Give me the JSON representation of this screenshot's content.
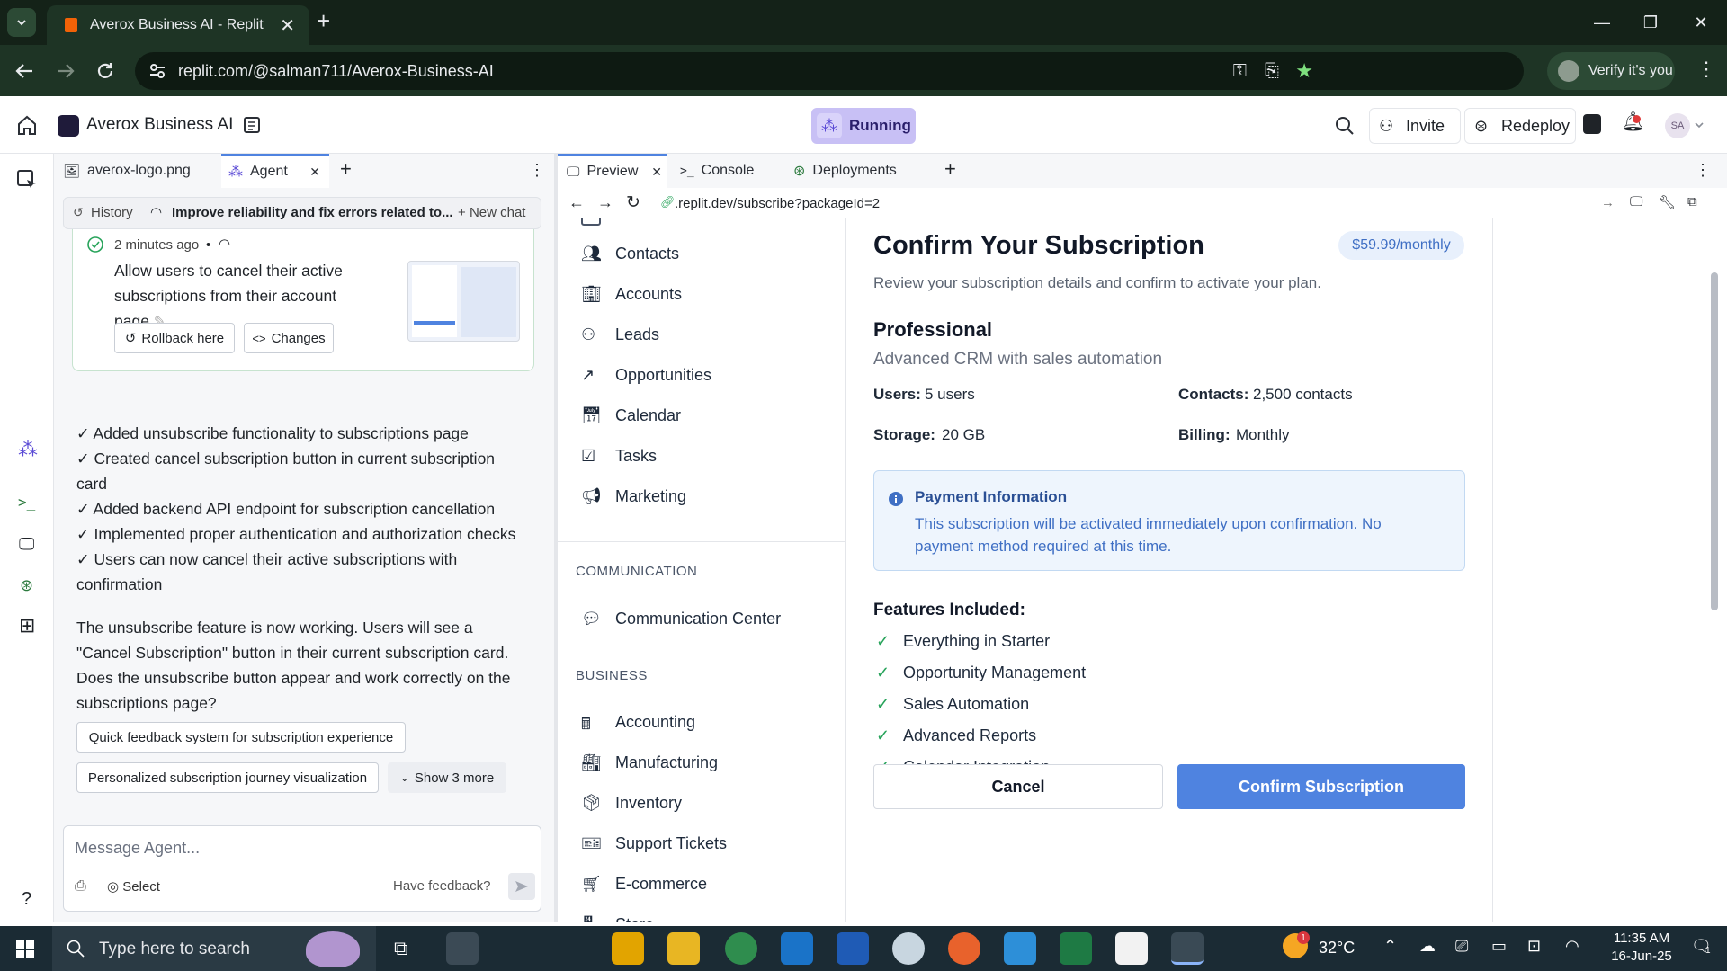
{
  "browser": {
    "tab_title": "Averox Business AI - Replit",
    "url": "replit.com/@salman711/Averox-Business-AI",
    "verify_label": "Verify it's you"
  },
  "app": {
    "project_name": "Averox Business AI",
    "status": "Running",
    "invite_label": "Invite",
    "redeploy_label": "Redeploy",
    "avatar_initials": "SA"
  },
  "left_tabs": {
    "file_tab": "averox-logo.png",
    "agent_tab": "Agent"
  },
  "agent": {
    "history_label": "History",
    "chat_title": "Improve reliability and fix errors related to...",
    "new_chat_label": "New chat",
    "checkpoint": {
      "time": "2 minutes ago",
      "bullet": "•",
      "message_lines": [
        "Allow users to cancel their active",
        "subscriptions from their account",
        "page"
      ],
      "rollback_label": "Rollback here",
      "changes_label": "Changes"
    },
    "changes": [
      "✓ Added unsubscribe functionality to subscriptions page",
      "✓ Created cancel subscription button in current subscription",
      "card",
      "✓ Added backend API endpoint for subscription cancellation",
      "✓ Implemented proper authentication and authorization checks",
      "✓ Users can now cancel their active subscriptions with",
      "confirmation"
    ],
    "summary_lines": [
      "The unsubscribe feature is now working. Users will see a",
      "\"Cancel Subscription\" button in their current subscription card.",
      "Does the unsubscribe button appear and work correctly on the",
      "subscriptions page?"
    ],
    "suggestions": [
      "Quick feedback system for subscription experience",
      "Personalized subscription journey visualization"
    ],
    "show_more": "Show 3 more",
    "input_placeholder": "Message Agent...",
    "select_label": "Select",
    "feedback_label": "Have feedback?",
    "help_label": "?"
  },
  "right_tabs": {
    "preview": "Preview",
    "console": "Console",
    "deployments": "Deployments"
  },
  "preview_url": ".replit.dev/subscribe?packageId=2",
  "crm": {
    "nav_main": [
      "Contacts",
      "Accounts",
      "Leads",
      "Opportunities",
      "Calendar",
      "Tasks",
      "Marketing"
    ],
    "section_communication": "COMMUNICATION",
    "nav_communication": [
      "Communication Center"
    ],
    "section_business": "BUSINESS",
    "nav_business": [
      "Accounting",
      "Manufacturing",
      "Inventory",
      "Support Tickets",
      "E-commerce",
      "Store"
    ]
  },
  "subscription": {
    "title": "Confirm Your Subscription",
    "price": "$59.99/monthly",
    "subtitle": "Review your subscription details and confirm to activate your plan.",
    "plan_name": "Professional",
    "plan_desc": "Advanced CRM with sales automation",
    "users_label": "Users:",
    "users_value": "5 users",
    "contacts_label": "Contacts:",
    "contacts_value": "2,500 contacts",
    "storage_label": "Storage:",
    "storage_value": "20 GB",
    "billing_label": "Billing:",
    "billing_value": "Monthly",
    "payment_title": "Payment Information",
    "payment_lines": [
      "This subscription will be activated immediately upon confirmation. No",
      "payment method required at this time."
    ],
    "features_title": "Features Included:",
    "features": [
      "Everything in Starter",
      "Opportunity Management",
      "Sales Automation",
      "Advanced Reports",
      "Calendar Integration"
    ],
    "cancel_label": "Cancel",
    "confirm_label": "Confirm Subscription"
  },
  "taskbar": {
    "search_placeholder": "Type here to search",
    "weather": "32°C",
    "time": "11:35 AM",
    "date": "16-Jun-25",
    "weather_badge": "1",
    "notif_count": "1"
  },
  "colors": {
    "accent": "#4f83e0",
    "running_bg": "#c8c0f5",
    "chrome_bg": "#142218",
    "check": "#27a35a"
  }
}
